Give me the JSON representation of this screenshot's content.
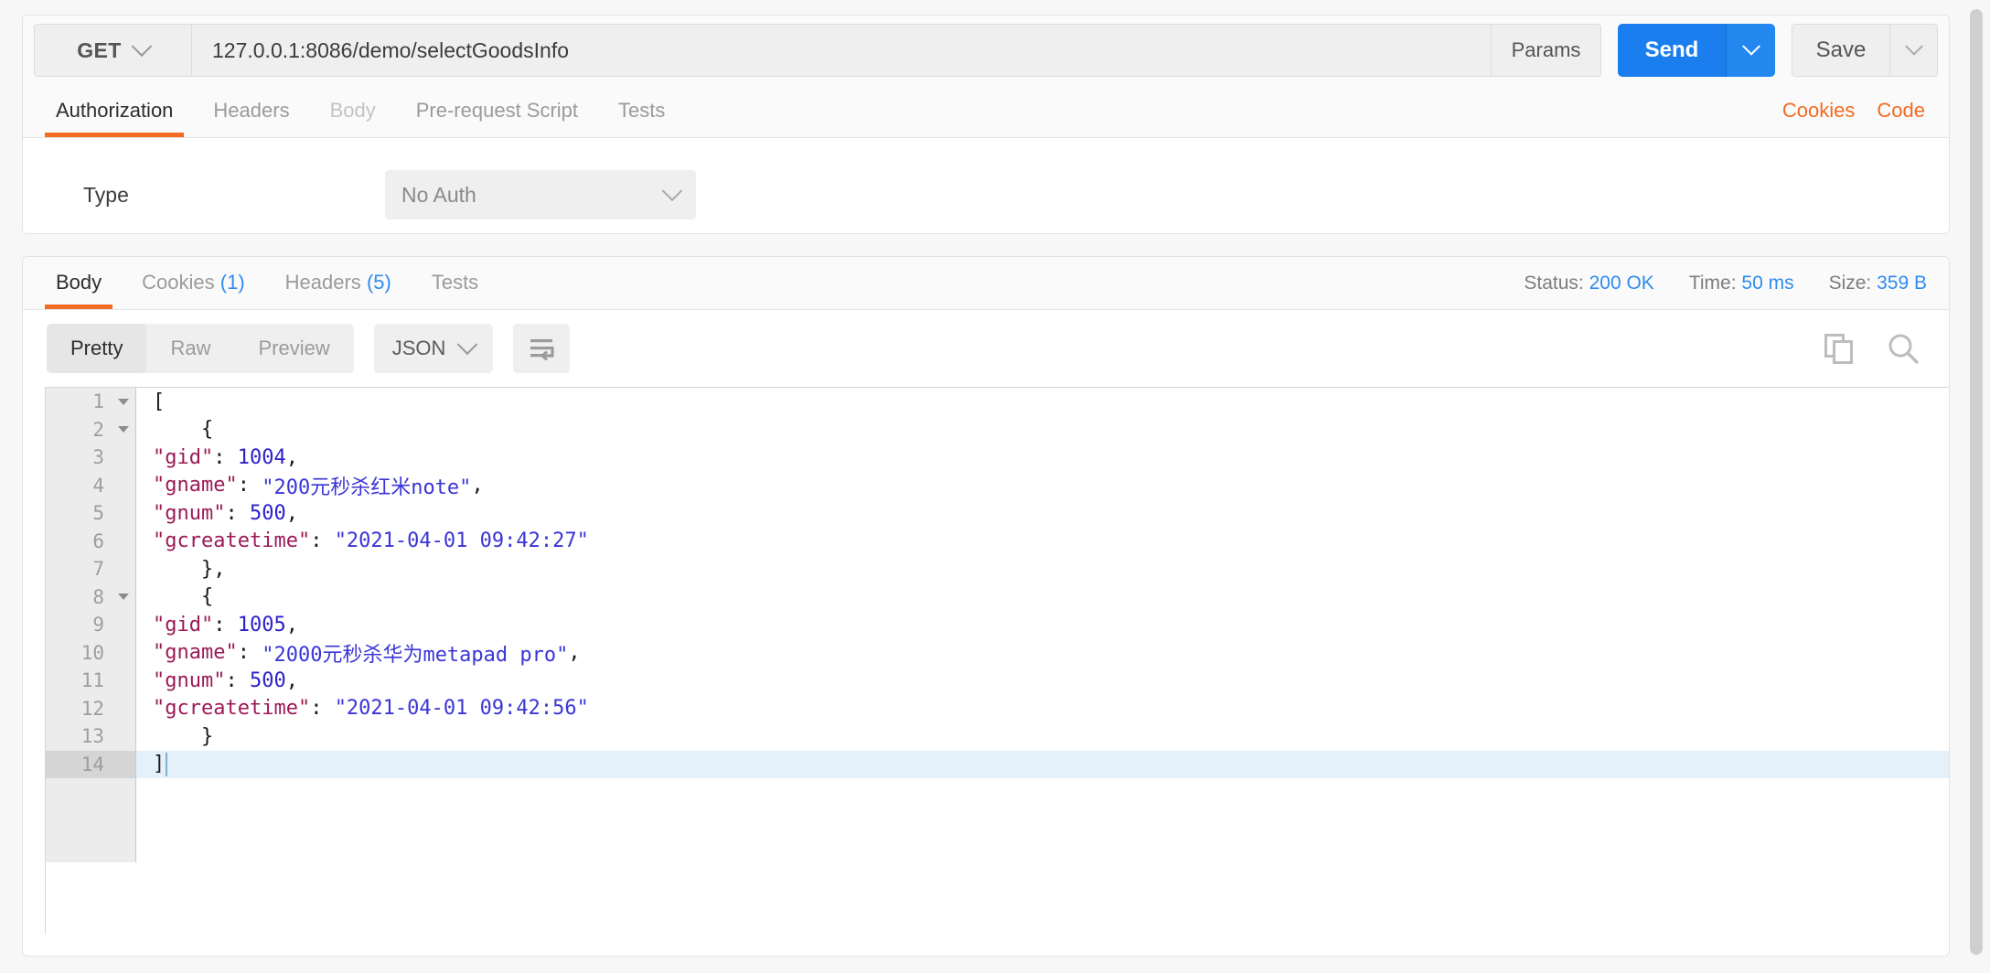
{
  "request": {
    "method": "GET",
    "url": "127.0.0.1:8086/demo/selectGoodsInfo",
    "url_placeholder": "Enter request URL",
    "params_label": "Params",
    "send_label": "Send",
    "save_label": "Save",
    "tabs": [
      {
        "label": "Authorization",
        "state": "active"
      },
      {
        "label": "Headers",
        "state": "normal"
      },
      {
        "label": "Body",
        "state": "disabled"
      },
      {
        "label": "Pre-request Script",
        "state": "normal"
      },
      {
        "label": "Tests",
        "state": "normal"
      }
    ],
    "links": [
      {
        "label": "Cookies"
      },
      {
        "label": "Code"
      }
    ],
    "auth": {
      "type_label": "Type",
      "type_value": "No Auth"
    }
  },
  "response": {
    "tabs": [
      {
        "label": "Body",
        "count": "",
        "state": "active"
      },
      {
        "label": "Cookies",
        "count": "(1)",
        "state": "normal"
      },
      {
        "label": "Headers",
        "count": "(5)",
        "state": "normal"
      },
      {
        "label": "Tests",
        "count": "",
        "state": "normal"
      }
    ],
    "meta": {
      "status_label": "Status:",
      "status_value": "200 OK",
      "time_label": "Time:",
      "time_value": "50 ms",
      "size_label": "Size:",
      "size_value": "359 B"
    },
    "view_modes": [
      {
        "label": "Pretty",
        "state": "active"
      },
      {
        "label": "Raw",
        "state": "normal"
      },
      {
        "label": "Preview",
        "state": "normal"
      }
    ],
    "format": "JSON",
    "icons": {
      "wrap": "wrap-lines-icon",
      "copy": "copy-icon",
      "search": "search-icon"
    },
    "body_lines": [
      {
        "no": "1",
        "foldable": true,
        "text": "[",
        "active": false
      },
      {
        "no": "2",
        "foldable": true,
        "text": "    {",
        "active": false
      },
      {
        "no": "3",
        "foldable": false,
        "text": "        \"gid\": 1004,",
        "active": false
      },
      {
        "no": "4",
        "foldable": false,
        "text": "        \"gname\": \"200元秒杀红米note\",",
        "active": false
      },
      {
        "no": "5",
        "foldable": false,
        "text": "        \"gnum\": 500,",
        "active": false
      },
      {
        "no": "6",
        "foldable": false,
        "text": "        \"gcreatetime\": \"2021-04-01 09:42:27\"",
        "active": false
      },
      {
        "no": "7",
        "foldable": false,
        "text": "    },",
        "active": false
      },
      {
        "no": "8",
        "foldable": true,
        "text": "    {",
        "active": false
      },
      {
        "no": "9",
        "foldable": false,
        "text": "        \"gid\": 1005,",
        "active": false
      },
      {
        "no": "10",
        "foldable": false,
        "text": "        \"gname\": \"2000元秒杀华为metapad pro\",",
        "active": false
      },
      {
        "no": "11",
        "foldable": false,
        "text": "        \"gnum\": 500,",
        "active": false
      },
      {
        "no": "12",
        "foldable": false,
        "text": "        \"gcreatetime\": \"2021-04-01 09:42:56\"",
        "active": false
      },
      {
        "no": "13",
        "foldable": false,
        "text": "    }",
        "active": false
      },
      {
        "no": "14",
        "foldable": false,
        "text": "]",
        "active": true
      }
    ],
    "body_json": [
      {
        "gid": 1004,
        "gname": "200元秒杀红米note",
        "gnum": 500,
        "gcreatetime": "2021-04-01 09:42:27"
      },
      {
        "gid": 1005,
        "gname": "2000元秒杀华为metapad pro",
        "gnum": 500,
        "gcreatetime": "2021-04-01 09:42:56"
      }
    ]
  },
  "colors": {
    "accent_orange": "#f26b21",
    "accent_blue": "#1a7eef",
    "link_blue": "#2f8ced",
    "json_key": "#9c1a57",
    "json_value": "#3a35d6"
  }
}
